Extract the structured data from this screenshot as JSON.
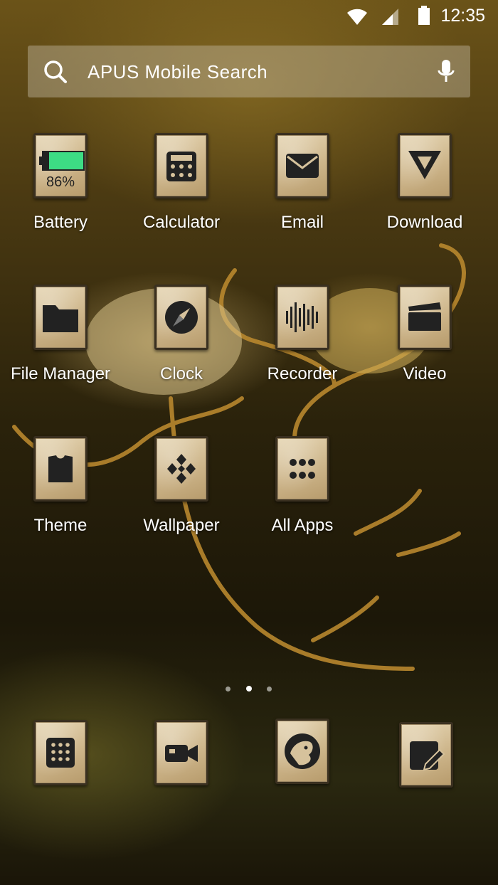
{
  "status_bar": {
    "time": "12:35",
    "icons": [
      "wifi-icon",
      "signal-icon",
      "battery-icon"
    ]
  },
  "search": {
    "placeholder": "APUS Mobile Search",
    "icons": [
      "search-icon",
      "mic-icon"
    ]
  },
  "apps": [
    {
      "label": "Battery",
      "icon": "battery-widget-icon",
      "value": "86%",
      "level": 0.86
    },
    {
      "label": "Calculator",
      "icon": "calculator-icon"
    },
    {
      "label": "Email",
      "icon": "email-icon"
    },
    {
      "label": "Download",
      "icon": "download-icon"
    },
    {
      "label": "File Manager",
      "icon": "folder-icon"
    },
    {
      "label": "Clock",
      "icon": "compass-icon"
    },
    {
      "label": "Recorder",
      "icon": "recorder-icon"
    },
    {
      "label": "Video",
      "icon": "clapperboard-icon"
    },
    {
      "label": "Theme",
      "icon": "shirt-icon"
    },
    {
      "label": "Wallpaper",
      "icon": "wallpaper-icon"
    },
    {
      "label": "All Apps",
      "icon": "grid-icon"
    }
  ],
  "page_indicator": {
    "count": 3,
    "active": 1
  },
  "dock": [
    {
      "icon": "dialer-icon"
    },
    {
      "icon": "camera-icon"
    },
    {
      "icon": "browser-icon"
    },
    {
      "icon": "messaging-icon"
    }
  ],
  "colors": {
    "battery_fill": "#3ddc84",
    "glyph": "#2b2b2b",
    "label": "#ffffff"
  }
}
